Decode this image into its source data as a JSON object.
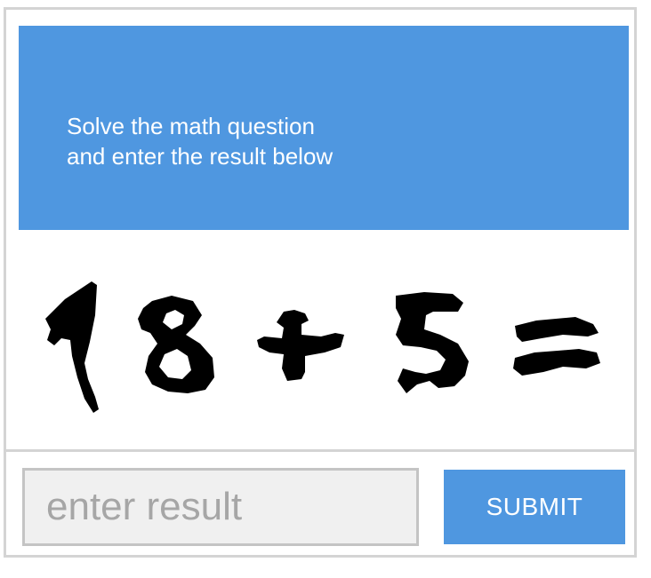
{
  "captcha": {
    "instructions": {
      "line1": "Solve the math question",
      "line2": "and enter the result below"
    },
    "challenge_text": "18 + 5 =",
    "input": {
      "value": "",
      "placeholder": "enter result"
    },
    "submit_label": "SUBMIT"
  },
  "colors": {
    "accent": "#4f97e0",
    "border": "#d4d4d4",
    "input_bg": "#f0f0f0",
    "placeholder": "#a6a6a6"
  }
}
